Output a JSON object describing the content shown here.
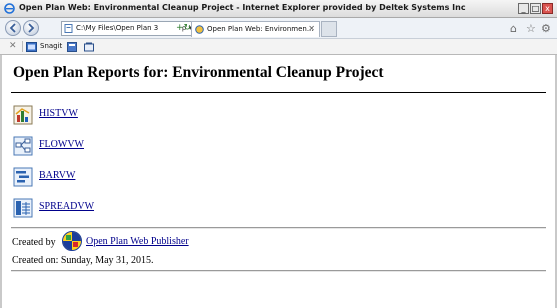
{
  "window": {
    "title": "Open Plan Web: Environmental Cleanup Project - Internet Explorer provided by Deltek Systems Inc",
    "minimize_glyph": "_",
    "maximize_glyph": "□",
    "close_glyph": "x"
  },
  "navbar": {
    "address": "C:\\My Files\\Open Plan 3",
    "address_controls": "ρ ▾",
    "refresh_glyph": "+↻",
    "tab_title": "Open Plan Web: Environmen...",
    "tab_close": "✕",
    "home_glyph": "⌂",
    "favorites_glyph": "☆",
    "tools_glyph": "⚙"
  },
  "commandbar": {
    "close_glyph": "✕",
    "snagit_label": "Snagit"
  },
  "page": {
    "heading": "Open Plan Reports for: Environmental Cleanup Project",
    "reports": [
      {
        "label": "HISTVW",
        "icon": "histogram-icon"
      },
      {
        "label": "FLOWVW",
        "icon": "flow-icon"
      },
      {
        "label": "BARVW",
        "icon": "bar-chart-icon"
      },
      {
        "label": "SPREADVW",
        "icon": "spreadsheet-icon"
      }
    ],
    "created_by_label": "Created by",
    "publisher_link": "Open Plan Web Publisher",
    "created_on": "Created on: Sunday, May 31, 2015."
  },
  "colors": {
    "link": "#00008b",
    "chrome": "#eef2f7"
  }
}
